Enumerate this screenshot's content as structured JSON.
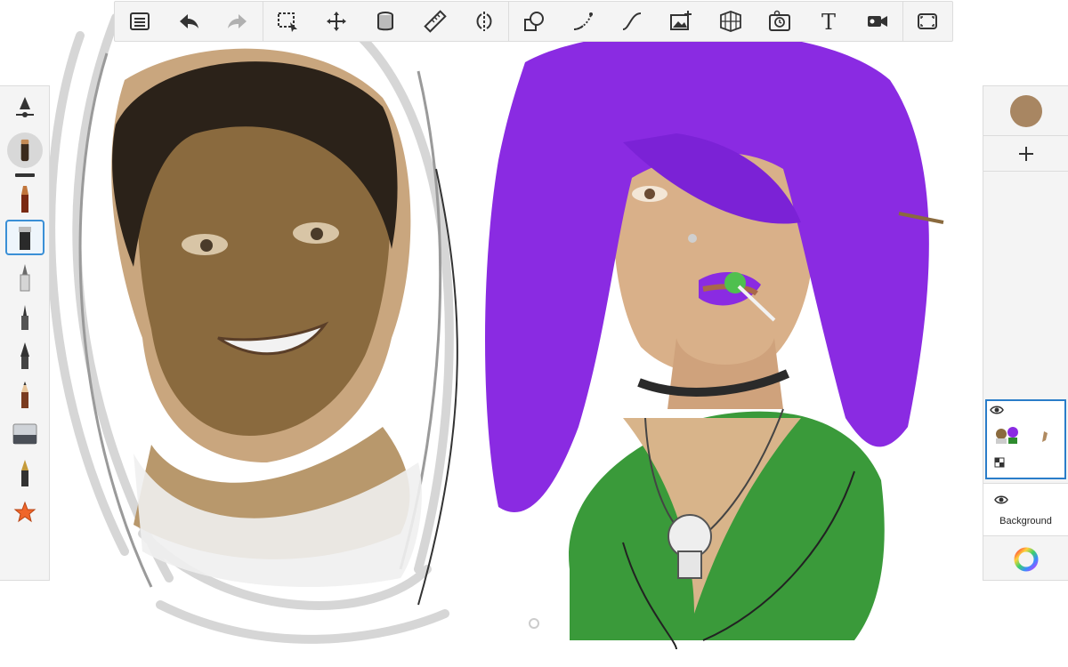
{
  "app": {
    "canvas_background": "#ffffff"
  },
  "toolbar": {
    "items": [
      {
        "name": "menu-list-icon"
      },
      {
        "name": "undo-icon"
      },
      {
        "name": "redo-icon",
        "disabled": true
      },
      {
        "name": "selection-icon"
      },
      {
        "name": "transform-icon"
      },
      {
        "name": "fill-bucket-icon"
      },
      {
        "name": "ruler-icon"
      },
      {
        "name": "symmetry-icon"
      },
      {
        "name": "shapes-icon"
      },
      {
        "name": "stroke-tool-icon"
      },
      {
        "name": "curve-icon"
      },
      {
        "name": "add-image-icon"
      },
      {
        "name": "perspective-grid-icon"
      },
      {
        "name": "time-lapse-icon"
      },
      {
        "name": "text-tool-icon",
        "glyph": "T"
      },
      {
        "name": "video-record-icon"
      },
      {
        "name": "fullscreen-icon"
      }
    ]
  },
  "brushes": {
    "items": [
      "brush-properties-icon",
      "current-brush-icon",
      "paint-brush-icon",
      "flat-brush-icon",
      "marker-icon",
      "pen-icon",
      "ink-pen-icon",
      "pencil-icon",
      "eraser-icon",
      "fountain-pen-icon",
      "favorites-star-icon"
    ],
    "selected": "flat-brush-icon"
  },
  "layers": {
    "current_color": "#a88662",
    "active_layer_visible": true,
    "background_label": "Background",
    "background_visible": true
  },
  "colors": {
    "accent": "#2a7dc9",
    "hair_purple": "#8a2be2",
    "shirt_green": "#2e8b2e",
    "skin_tone": "#8a6a3e"
  }
}
